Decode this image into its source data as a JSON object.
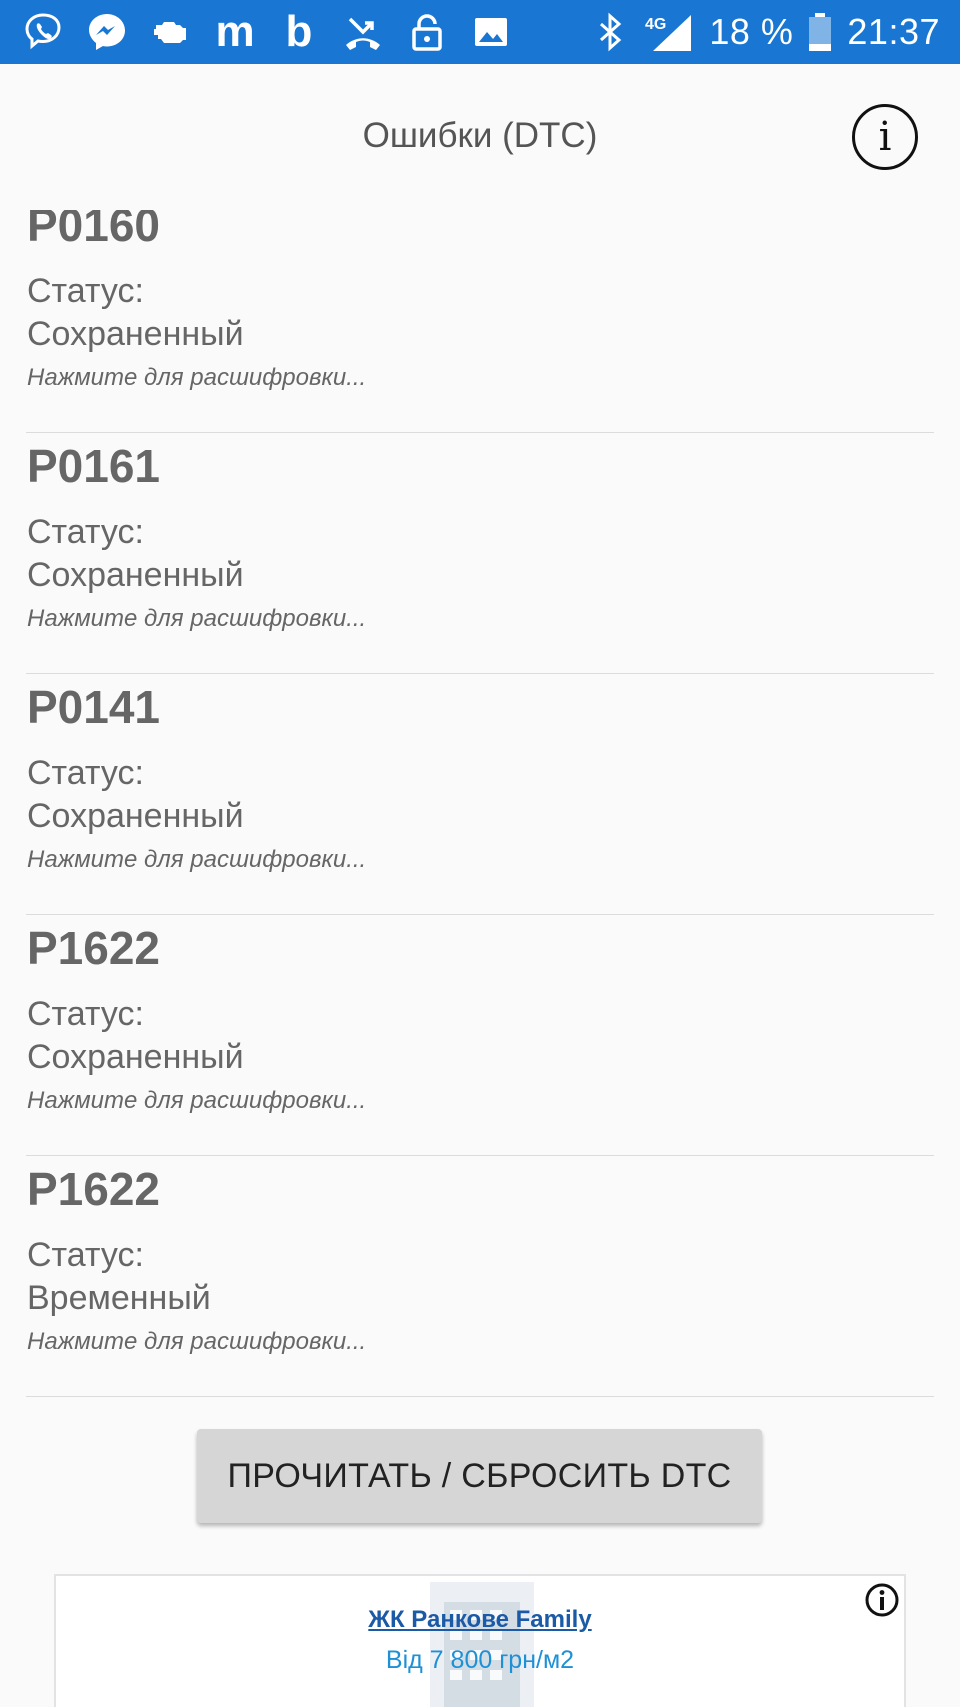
{
  "status_bar": {
    "left_icons": [
      "viber-icon",
      "messenger-icon",
      "car-engine-icon",
      "m-app-icon",
      "b-app-icon",
      "missed-call-icon",
      "lock-icon",
      "image-icon"
    ],
    "m_letter": "m",
    "b_letter": "b",
    "network": "4G",
    "battery_percent": "18 %",
    "time": "21:37"
  },
  "app_bar": {
    "title": "Ошибки (DTC)",
    "info_glyph": "i"
  },
  "dtc_list": {
    "status_label": "Статус:",
    "hint": "Нажмите для расшифровки...",
    "items": [
      {
        "code": "P0160",
        "status": "Сохраненный"
      },
      {
        "code": "P0161",
        "status": "Сохраненный"
      },
      {
        "code": "P0141",
        "status": "Сохраненный"
      },
      {
        "code": "P1622",
        "status": "Сохраненный"
      },
      {
        "code": "P1622",
        "status": "Временный"
      }
    ]
  },
  "actions": {
    "read_reset_label": "ПРОЧИТАТЬ / СБРОСИТЬ DTC"
  },
  "ad": {
    "title": "ЖК Ранкове Family",
    "price": "Від 7 800 грн/м2"
  },
  "colors": {
    "status_bar": "#1976d2",
    "background": "#fafafa",
    "text_gray": "#666666",
    "button_gray": "#d6d6d6",
    "ad_link": "#1a5aa6",
    "ad_price": "#1e90d6"
  }
}
